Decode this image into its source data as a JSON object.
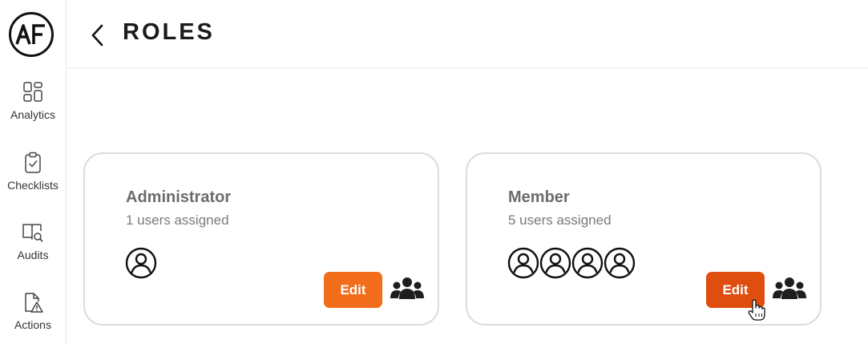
{
  "logo": {
    "text": "AF"
  },
  "sidebar": {
    "items": [
      {
        "label": "Analytics",
        "icon": "analytics-icon"
      },
      {
        "label": "Checklists",
        "icon": "checklist-icon"
      },
      {
        "label": "Audits",
        "icon": "audit-icon"
      },
      {
        "label": "Actions",
        "icon": "actions-icon"
      }
    ]
  },
  "header": {
    "title": "ROLES",
    "back_icon": "chevron-left-icon"
  },
  "roles": [
    {
      "name": "Administrator",
      "subtitle": "1 users assigned",
      "avatar_count": 1,
      "edit_label": "Edit",
      "edit_color": "#f26d1b",
      "state": "default"
    },
    {
      "name": "Member",
      "subtitle": "5 users assigned",
      "avatar_count": 4,
      "edit_label": "Edit",
      "edit_color": "#e04e0f",
      "state": "hover"
    }
  ],
  "colors": {
    "accent": "#f26d1b",
    "accent_hover": "#e04e0f",
    "border": "#dcdcdc"
  }
}
